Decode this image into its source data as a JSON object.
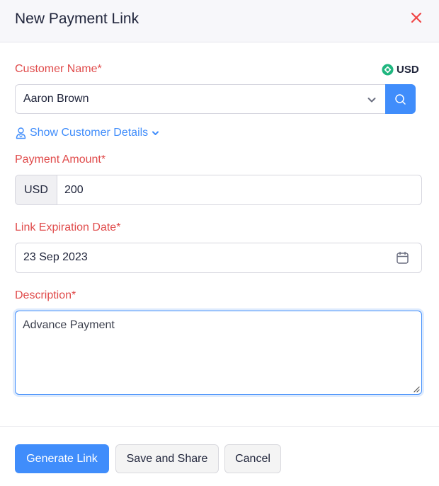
{
  "modal": {
    "title": "New Payment Link",
    "close_icon": "close-x-icon"
  },
  "form": {
    "customer": {
      "label": "Customer Name*",
      "value": "Aaron Brown",
      "currency_badge": "USD",
      "currency_icon": "currency-eye-icon",
      "show_details_label": "Show Customer Details"
    },
    "amount": {
      "label": "Payment Amount*",
      "currency_prefix": "USD",
      "value": "200"
    },
    "expiration": {
      "label": "Link Expiration Date*",
      "value": "23 Sep 2023"
    },
    "description": {
      "label": "Description*",
      "value": "Advance Payment"
    }
  },
  "footer": {
    "generate_label": "Generate Link",
    "save_share_label": "Save and Share",
    "cancel_label": "Cancel"
  },
  "colors": {
    "accent": "#408dfb",
    "required_label": "#e04b4b",
    "close": "#f04646",
    "currency_icon": "#1fb67f"
  }
}
